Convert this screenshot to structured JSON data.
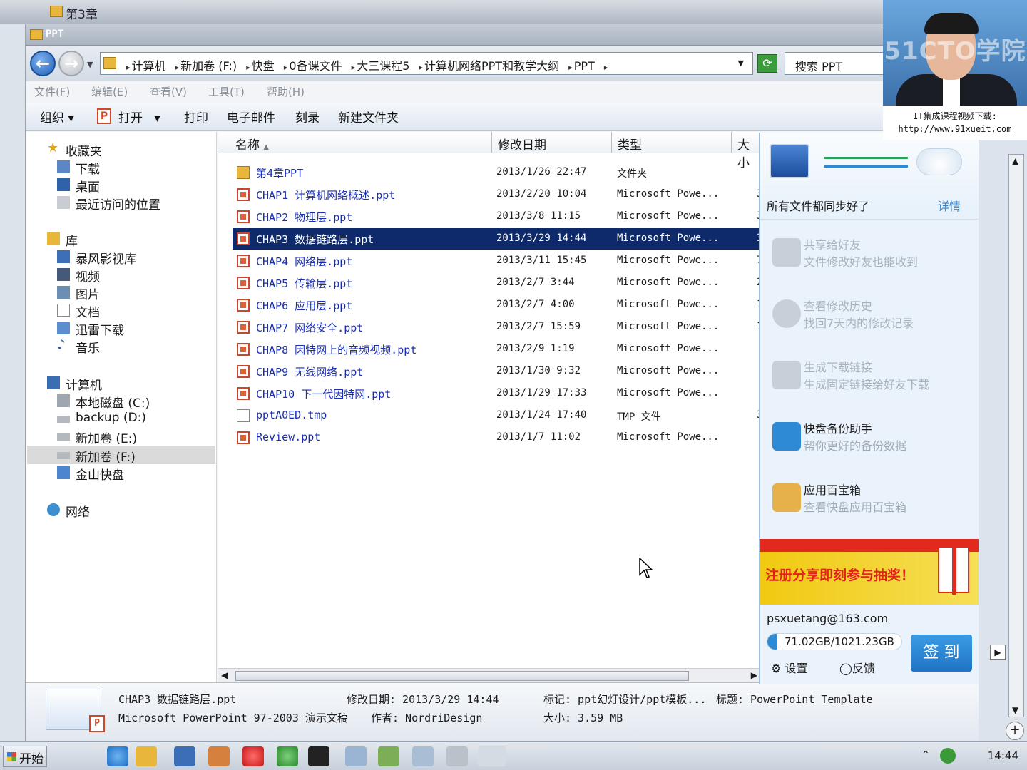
{
  "bg_window": {
    "title": "第3章"
  },
  "window": {
    "title": "PPT",
    "breadcrumbs": [
      "计算机",
      "新加卷 (F:)",
      "快盘",
      "0备课文件",
      "大三课程5",
      "计算机网络PPT和教学大纲",
      "PPT"
    ],
    "search_placeholder": "搜索 PPT",
    "menu": [
      "文件(F)",
      "编辑(E)",
      "查看(V)",
      "工具(T)",
      "帮助(H)"
    ],
    "toolbar": {
      "organize": "组织",
      "open": "打开",
      "print": "打印",
      "email": "电子邮件",
      "burn": "刻录",
      "new_folder": "新建文件夹"
    }
  },
  "nav": {
    "favorites": {
      "label": "收藏夹",
      "items": [
        "下载",
        "桌面",
        "最近访问的位置"
      ]
    },
    "library": {
      "label": "库",
      "items": [
        "暴风影视库",
        "视频",
        "图片",
        "文档",
        "迅雷下载",
        "音乐"
      ]
    },
    "computer": {
      "label": "计算机",
      "items": [
        "本地磁盘 (C:)",
        "backup (D:)",
        "新加卷 (E:)",
        "新加卷 (F:)",
        "金山快盘"
      ]
    },
    "network": {
      "label": "网络"
    }
  },
  "columns": {
    "name": "名称",
    "modified": "修改日期",
    "type": "类型",
    "size": "大小"
  },
  "files": [
    {
      "name": "第4章PPT",
      "date": "2013/1/26 22:47",
      "type": "文件夹",
      "size": "",
      "kind": "folder"
    },
    {
      "name": "CHAP1 计算机网络概述.ppt",
      "date": "2013/2/20 10:04",
      "type": "Microsoft Powe...",
      "size": "3",
      "kind": "ppt"
    },
    {
      "name": "CHAP2 物理层.ppt",
      "date": "2013/3/8 11:15",
      "type": "Microsoft Powe...",
      "size": "3",
      "kind": "ppt"
    },
    {
      "name": "CHAP3 数据链路层.ppt",
      "date": "2013/3/29 14:44",
      "type": "Microsoft Powe...",
      "size": "3",
      "kind": "ppt",
      "selected": true
    },
    {
      "name": "CHAP4 网络层.ppt",
      "date": "2013/3/11 15:45",
      "type": "Microsoft Powe...",
      "size": "7",
      "kind": "ppt"
    },
    {
      "name": "CHAP5 传输层.ppt",
      "date": "2013/2/7 3:44",
      "type": "Microsoft Powe...",
      "size": "2",
      "kind": "ppt"
    },
    {
      "name": "CHAP6 应用层.ppt",
      "date": "2013/2/7 4:00",
      "type": "Microsoft Powe...",
      "size": "1",
      "kind": "ppt"
    },
    {
      "name": "CHAP7 网络安全.ppt",
      "date": "2013/2/7 15:59",
      "type": "Microsoft Powe...",
      "size": "1",
      "kind": "ppt"
    },
    {
      "name": "CHAP8 因特网上的音频视频.ppt",
      "date": "2013/2/9 1:19",
      "type": "Microsoft Powe...",
      "size": "",
      "kind": "ppt"
    },
    {
      "name": "CHAP9 无线网络.ppt",
      "date": "2013/1/30 9:32",
      "type": "Microsoft Powe...",
      "size": "",
      "kind": "ppt"
    },
    {
      "name": "CHAP10 下一代因特网.ppt",
      "date": "2013/1/29 17:33",
      "type": "Microsoft Powe...",
      "size": "",
      "kind": "ppt"
    },
    {
      "name": "pptA0ED.tmp",
      "date": "2013/1/24 17:40",
      "type": "TMP 文件",
      "size": "3",
      "kind": "tmp"
    },
    {
      "name": "Review.ppt",
      "date": "2013/1/7 11:02",
      "type": "Microsoft Powe...",
      "size": "",
      "kind": "ppt"
    }
  ],
  "details": {
    "filename": "CHAP3 数据链路层.ppt",
    "filetype": "Microsoft PowerPoint 97-2003 演示文稿",
    "modified": "修改日期: 2013/3/29 14:44",
    "author": "作者: NordriDesign",
    "tags": "标记: ppt幻灯设计/ppt模板...",
    "size": "大小: 3.59 MB",
    "title": "标题: PowerPoint Template"
  },
  "panel": {
    "status": "所有文件都同步好了",
    "detail_link": "详情",
    "features": [
      {
        "title": "共享给好友",
        "desc": "文件修改好友也能收到",
        "dim": true
      },
      {
        "title": "查看修改历史",
        "desc": "找回7天内的修改记录",
        "dim": true
      },
      {
        "title": "生成下载链接",
        "desc": "生成固定链接给好友下载",
        "dim": true
      },
      {
        "title": "快盘备份助手",
        "desc": "帮你更好的备份数据",
        "dim": false
      },
      {
        "title": "应用百宝箱",
        "desc": "查看快盘应用百宝箱",
        "dim": false
      }
    ],
    "promo": "注册分享即刻参与抽奖！",
    "email": "psxuetang@163.com",
    "quota": "71.02GB/1021.23GB",
    "quota_used_fraction": 0.07,
    "signin": "签 到",
    "settings": "设置",
    "feedback": "反馈"
  },
  "webcam": {
    "logo": "51CTO学院",
    "caption_line1": "IT集成课程视频下载:",
    "caption_line2": "http://www.91xueit.com"
  },
  "taskbar": {
    "start": "开始",
    "clock": "14:44"
  },
  "colors": {
    "selection": "#0f2a6a",
    "link": "#1a2eb0",
    "accent": "#2f8ad6",
    "promo_red": "#e2231a"
  }
}
